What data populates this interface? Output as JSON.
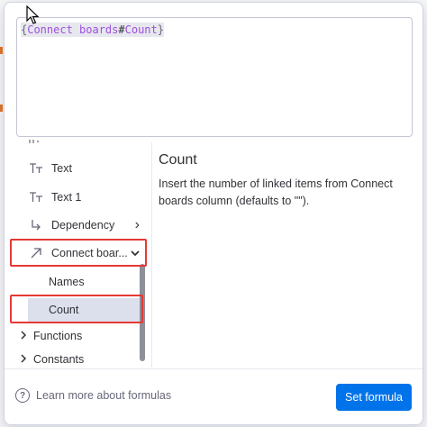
{
  "formula": {
    "open_brace": "{",
    "function": "Connect boards",
    "hash": "#",
    "property": "Count",
    "close_brace": "}"
  },
  "left_panel": {
    "partial_item": "· ·",
    "items": [
      {
        "label": "Text",
        "icon": "text-type-icon"
      },
      {
        "label": "Text 1",
        "icon": "text-type-icon"
      },
      {
        "label": "Dependency",
        "icon": "dependency-icon",
        "chevron": "›"
      },
      {
        "label": "Connect boar...",
        "icon": "connect-arrow-icon",
        "chevron": "⌄"
      }
    ],
    "subitems": [
      {
        "label": "Names"
      },
      {
        "label": "Count",
        "selected": true
      }
    ],
    "categories": [
      {
        "label": "Functions",
        "chevron": "›"
      },
      {
        "label": "Constants",
        "chevron": "›"
      }
    ]
  },
  "detail": {
    "title": "Count",
    "description": "Insert the number of linked items from Connect boards column (defaults to \"\")."
  },
  "footer": {
    "help_icon": "?",
    "help_text": "Learn more about formulas",
    "set_button": "Set formula"
  },
  "colors": {
    "accent": "#0073ea",
    "highlight_box": "#e53935",
    "selected_row": "#dcdfec",
    "function_token": "#9d50dd"
  }
}
